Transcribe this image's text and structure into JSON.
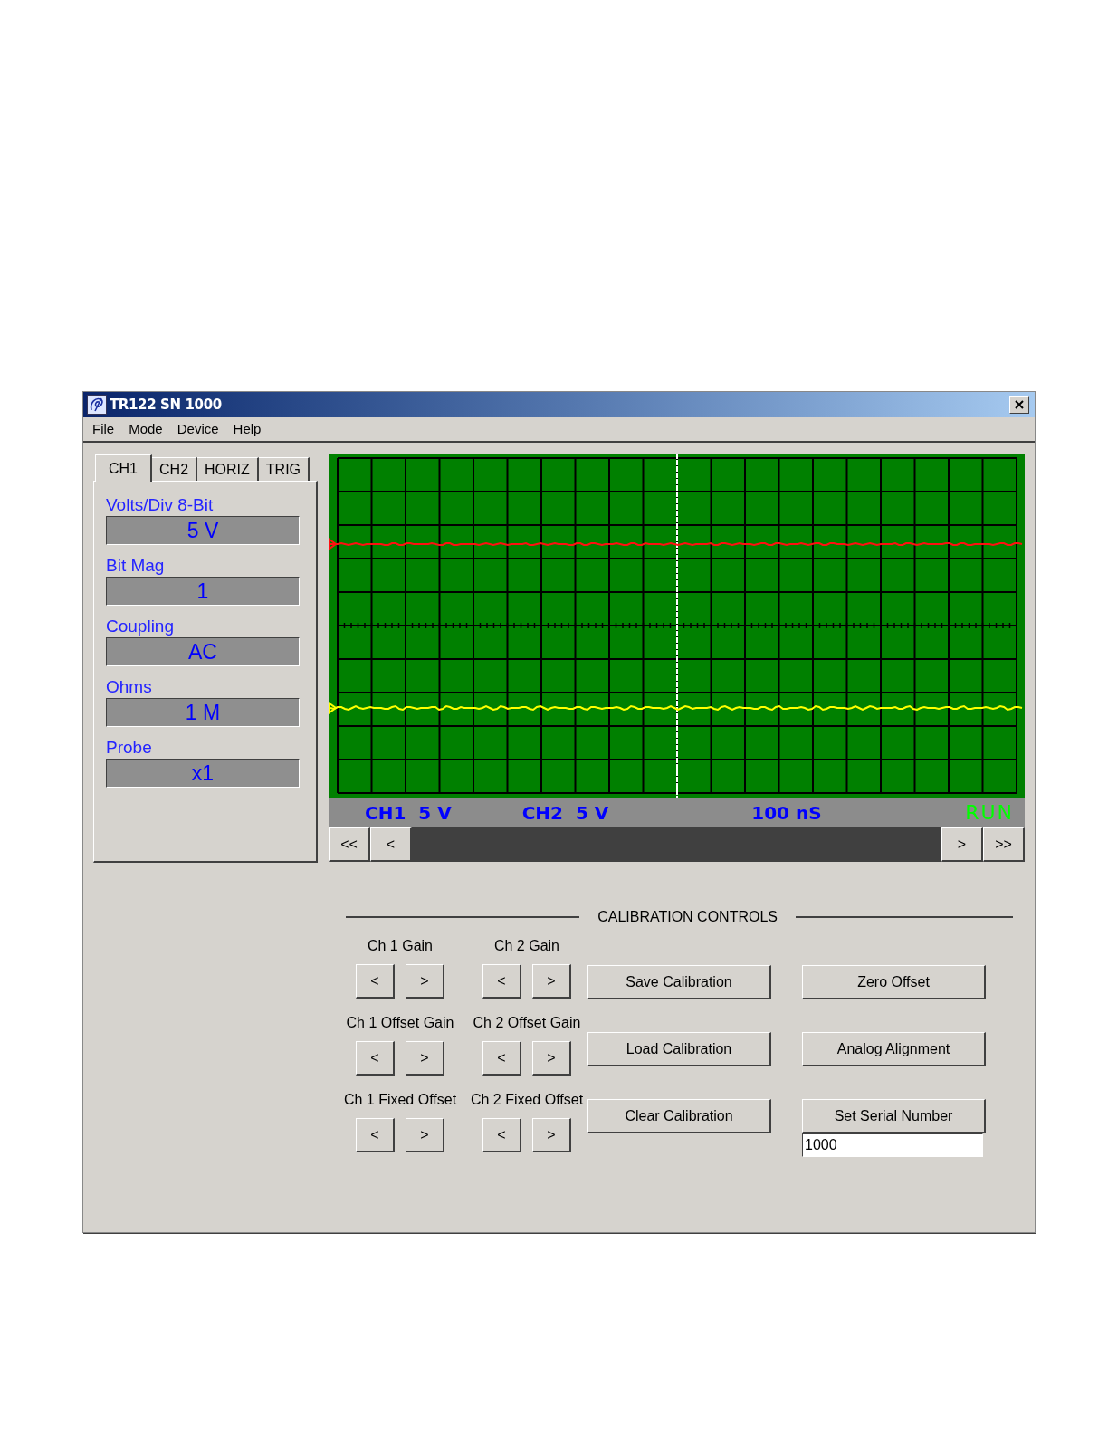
{
  "window": {
    "title": "TR122 SN 1000"
  },
  "menu": [
    "File",
    "Mode",
    "Device",
    "Help"
  ],
  "tabs": [
    {
      "label": "CH1",
      "selected": true
    },
    {
      "label": "CH2",
      "selected": false
    },
    {
      "label": "HORIZ",
      "selected": false
    },
    {
      "label": "TRIG",
      "selected": false
    }
  ],
  "channel_settings": [
    {
      "label": "Volts/Div 8-Bit",
      "value": "5 V"
    },
    {
      "label": "Bit Mag",
      "value": "1"
    },
    {
      "label": "Coupling",
      "value": "AC"
    },
    {
      "label": "Ohms",
      "value": "1 M"
    },
    {
      "label": "Probe",
      "value": "x1"
    }
  ],
  "scope_status": {
    "ch1": "CH1  5 V",
    "ch2": "CH2  5 V",
    "timebase": "100 nS",
    "run_state": "RUN"
  },
  "scroll_left": [
    "<<",
    "<"
  ],
  "scroll_right": [
    ">",
    ">>"
  ],
  "calibration": {
    "title": "CALIBRATION CONTROLS",
    "steppers": [
      {
        "label": "Ch 1 Gain",
        "buttons": [
          "<",
          ">"
        ]
      },
      {
        "label": "Ch 2 Gain",
        "buttons": [
          "<",
          ">"
        ]
      },
      {
        "label": "Ch 1 Offset Gain",
        "buttons": [
          "<",
          ">"
        ]
      },
      {
        "label": "Ch 2 Offset Gain",
        "buttons": [
          "<",
          ">"
        ]
      },
      {
        "label": "Ch 1 Fixed Offset",
        "buttons": [
          "<",
          ">"
        ]
      },
      {
        "label": "Ch 2 Fixed Offset",
        "buttons": [
          "<",
          ">"
        ]
      }
    ],
    "file_buttons": [
      "Save Calibration",
      "Load Calibration",
      "Clear Calibration"
    ],
    "tool_buttons": [
      "Zero Offset",
      "Analog Alignment",
      "Set Serial Number"
    ],
    "serial_number": {
      "value": "1000"
    }
  }
}
